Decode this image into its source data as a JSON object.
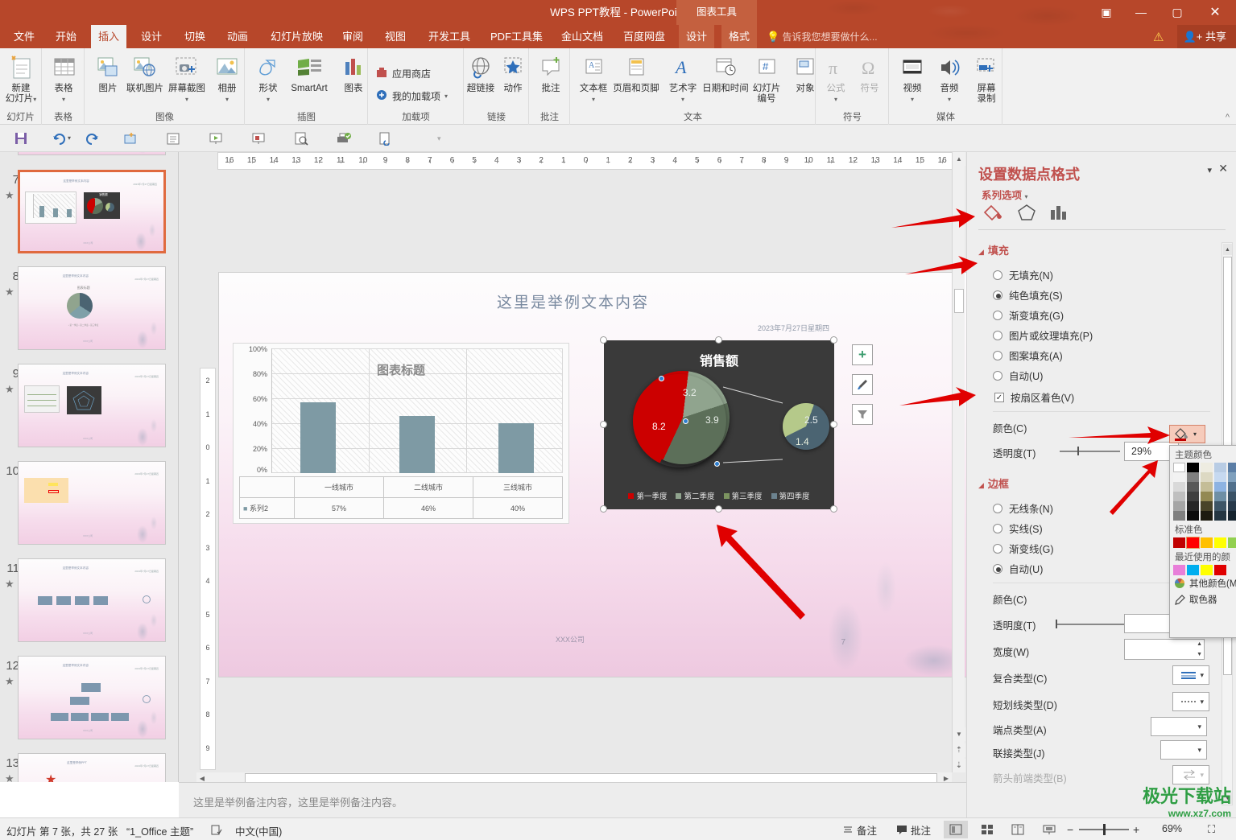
{
  "window": {
    "title": "WPS PPT教程 - PowerPoint",
    "chart_tools_label": "图表工具",
    "buttons": {
      "ribbon": "▣",
      "minimize": "—",
      "maximize": "▢",
      "close": "✕"
    }
  },
  "tabs": [
    {
      "label": "文件",
      "active": false
    },
    {
      "label": "开始",
      "active": false
    },
    {
      "label": "插入",
      "active": true
    },
    {
      "label": "设计",
      "active": false
    },
    {
      "label": "切换",
      "active": false
    },
    {
      "label": "动画",
      "active": false
    },
    {
      "label": "幻灯片放映",
      "active": false
    },
    {
      "label": "审阅",
      "active": false
    },
    {
      "label": "视图",
      "active": false
    },
    {
      "label": "开发工具",
      "active": false
    },
    {
      "label": "PDF工具集",
      "active": false
    },
    {
      "label": "金山文档",
      "active": false
    },
    {
      "label": "百度网盘",
      "active": false
    }
  ],
  "context_tabs": [
    {
      "label": "设计"
    },
    {
      "label": "格式"
    }
  ],
  "tell_me": "告诉我您想要做什么...",
  "share_label": "共享",
  "ribbon": {
    "groups": [
      {
        "label": "幻灯片",
        "items": [
          {
            "label": "新建\n幻灯片",
            "icon": "new-slide-icon",
            "dropdown": true
          }
        ]
      },
      {
        "label": "表格",
        "items": [
          {
            "label": "表格",
            "icon": "table-icon",
            "dropdown": true
          }
        ]
      },
      {
        "label": "图像",
        "items": [
          {
            "label": "图片",
            "icon": "picture-icon"
          },
          {
            "label": "联机图片",
            "icon": "online-picture-icon"
          },
          {
            "label": "屏幕截图",
            "icon": "screenshot-icon",
            "dropdown": true
          },
          {
            "label": "相册",
            "icon": "album-icon",
            "dropdown": true
          }
        ]
      },
      {
        "label": "插图",
        "items": [
          {
            "label": "形状",
            "icon": "shapes-icon",
            "dropdown": true
          },
          {
            "label": "SmartArt",
            "icon": "smartart-icon"
          },
          {
            "label": "图表",
            "icon": "chart-icon"
          }
        ]
      },
      {
        "label": "加载项",
        "items": [
          {
            "label": "应用商店",
            "icon": "store-icon"
          },
          {
            "label": "我的加载项",
            "icon": "my-addins-icon",
            "dropdown": true
          }
        ]
      },
      {
        "label": "链接",
        "items": [
          {
            "label": "超链接",
            "icon": "hyperlink-icon"
          },
          {
            "label": "动作",
            "icon": "action-icon"
          }
        ]
      },
      {
        "label": "批注",
        "items": [
          {
            "label": "批注",
            "icon": "comment-icon"
          }
        ]
      },
      {
        "label": "文本",
        "items": [
          {
            "label": "文本框",
            "icon": "textbox-icon",
            "dropdown": true
          },
          {
            "label": "页眉和页脚",
            "icon": "header-footer-icon"
          },
          {
            "label": "艺术字",
            "icon": "wordart-icon",
            "dropdown": true
          },
          {
            "label": "日期和时间",
            "icon": "date-time-icon"
          },
          {
            "label": "幻灯片\n编号",
            "icon": "slide-number-icon"
          },
          {
            "label": "对象",
            "icon": "object-icon"
          }
        ]
      },
      {
        "label": "符号",
        "items": [
          {
            "label": "公式",
            "icon": "equation-icon",
            "dropdown": true,
            "disabled": true
          },
          {
            "label": "符号",
            "icon": "symbol-icon",
            "disabled": true
          }
        ]
      },
      {
        "label": "媒体",
        "items": [
          {
            "label": "视频",
            "icon": "video-icon",
            "dropdown": true
          },
          {
            "label": "音频",
            "icon": "audio-icon",
            "dropdown": true
          },
          {
            "label": "屏幕\n录制",
            "icon": "screen-record-icon"
          }
        ]
      }
    ]
  },
  "qat": [
    {
      "name": "save-icon"
    },
    {
      "name": "undo-icon"
    },
    {
      "name": "redo-icon"
    },
    {
      "name": "new-slide-icon"
    },
    {
      "name": "outline-icon"
    },
    {
      "name": "slideshow-icon"
    },
    {
      "name": "present-icon"
    },
    {
      "name": "preview-icon"
    },
    {
      "name": "print-icon"
    },
    {
      "name": "link-doc-icon"
    },
    {
      "name": "qat-more-icon"
    }
  ],
  "thumbnails": [
    {
      "num": "7",
      "starred": true,
      "selected": true,
      "kind": "charts"
    },
    {
      "num": "8",
      "starred": true,
      "selected": false,
      "kind": "pie"
    },
    {
      "num": "9",
      "starred": true,
      "selected": false,
      "kind": "radar"
    },
    {
      "num": "10",
      "starred": false,
      "selected": false,
      "kind": "mindmap"
    },
    {
      "num": "11",
      "starred": true,
      "selected": false,
      "kind": "process"
    },
    {
      "num": "12",
      "starred": true,
      "selected": false,
      "kind": "orgchart"
    },
    {
      "num": "13",
      "starred": true,
      "selected": false,
      "kind": "icons"
    }
  ],
  "slide": {
    "title": "这里是举例文本内容",
    "date": "2023年7月27日星期四",
    "footer": "XXX公司",
    "page_number": "7"
  },
  "chart_data": [
    {
      "type": "bar",
      "title": "图表标题",
      "categories": [
        "一线城市",
        "二线城市",
        "三线城市"
      ],
      "series": [
        {
          "name": "系列2",
          "values": [
            57,
            46,
            40
          ],
          "labels": [
            "57%",
            "46%",
            "40%"
          ]
        }
      ],
      "ylabel": "",
      "xlabel": "",
      "ylim": [
        0,
        100
      ],
      "ytick_labels": [
        "100%",
        "80%",
        "60%",
        "40%",
        "20%",
        "0%"
      ],
      "grid": true,
      "legend_position": "table",
      "data_table": true,
      "bar_color": "#7e9aa4",
      "plot_bg": "#fdfdfd"
    },
    {
      "type": "pie",
      "subtype": "pie-of-pie",
      "title": "销售额",
      "categories": [
        "第一季度",
        "第二季度",
        "第三季度",
        "第四季度"
      ],
      "values": [
        8.2,
        3.2,
        3.9,
        2.5,
        1.4
      ],
      "data_labels": [
        "8.2",
        "3.2",
        "3.9",
        "2.5",
        "1.4"
      ],
      "legend": [
        "第一季度",
        "第二季度",
        "第三季度",
        "第四季度"
      ],
      "legend_position": "bottom",
      "colors": [
        "#cc0000",
        "#90a48e",
        "#5c6f59",
        "#4b6472",
        "#b5c98a"
      ],
      "background": "#3a3a3a",
      "selected_slice": "第一季度"
    }
  ],
  "chart_side_buttons": [
    {
      "name": "chart-elements-button",
      "glyph": "+"
    },
    {
      "name": "chart-styles-button",
      "glyph": "brush"
    },
    {
      "name": "chart-filters-button",
      "glyph": "funnel"
    }
  ],
  "taskpane": {
    "title": "设置数据点格式",
    "subtitle": "系列选项",
    "minimize": "▾",
    "close": "✕",
    "tabs": [
      {
        "name": "fill-line-icon",
        "active": true
      },
      {
        "name": "effects-icon",
        "active": false
      },
      {
        "name": "series-options-icon",
        "active": false
      }
    ],
    "fill": {
      "heading": "填充",
      "options": [
        {
          "label": "无填充(N)",
          "selected": false
        },
        {
          "label": "纯色填充(S)",
          "selected": true
        },
        {
          "label": "渐变填充(G)",
          "selected": false
        },
        {
          "label": "图片或纹理填充(P)",
          "selected": false
        },
        {
          "label": "图案填充(A)",
          "selected": false
        },
        {
          "label": "自动(U)",
          "selected": false
        }
      ],
      "checkbox": {
        "label": "按扇区着色(V)",
        "checked": true
      },
      "color_label": "颜色(C)",
      "transparency_label": "透明度(T)",
      "transparency_value": "29%"
    },
    "border": {
      "heading": "边框",
      "options": [
        {
          "label": "无线条(N)",
          "selected": false
        },
        {
          "label": "实线(S)",
          "selected": false
        },
        {
          "label": "渐变线(G)",
          "selected": false
        },
        {
          "label": "自动(U)",
          "selected": true
        }
      ],
      "rows": [
        {
          "label": "颜色(C)",
          "control": "color"
        },
        {
          "label": "透明度(T)",
          "control": "slider",
          "value": ""
        },
        {
          "label": "宽度(W)",
          "control": "spinner",
          "value": ""
        },
        {
          "label": "复合类型(C)",
          "control": "dropdown",
          "value": ""
        },
        {
          "label": "短划线类型(D)",
          "control": "dropdown",
          "value": ""
        },
        {
          "label": "端点类型(A)",
          "control": "dropdown",
          "value": ""
        },
        {
          "label": "联接类型(J)",
          "control": "dropdown",
          "value": ""
        },
        {
          "label": "箭头前端类型(B)",
          "control": "dropdown",
          "value": "",
          "disabled": true
        }
      ]
    }
  },
  "color_dropdown": {
    "theme_heading": "主题颜色",
    "standard_heading": "标准色",
    "recent_heading": "最近使用的颜",
    "theme_row1": [
      "#ffffff",
      "#000000",
      "#eeece1",
      "#b8cce4",
      "#5b7ea6"
    ],
    "theme_shades": [
      [
        "#f2f2f2",
        "#d9d9d9",
        "#bfbfbf",
        "#a6a6a6",
        "#808080"
      ],
      [
        "#7f7f7f",
        "#595959",
        "#3f3f3f",
        "#262626",
        "#0c0c0c"
      ],
      [
        "#ddd9c3",
        "#c4bd97",
        "#938953",
        "#494429",
        "#1d1b10"
      ],
      [
        "#c6d9f0",
        "#8db3e2",
        "#548dd4",
        "#17365d",
        "#0f243e"
      ],
      [
        "#dbe5f1",
        "#b8cce4",
        "#95b3d7",
        "#366092",
        "#244061"
      ]
    ],
    "standard_colors": [
      "#c00000",
      "#ff0000",
      "#ffc000",
      "#ffff00",
      "#92d050"
    ],
    "recent_colors": [
      "#e87fd9",
      "#00aeef",
      "#ffff00",
      "#e00000"
    ],
    "more_colors_label": "其他颜色(M",
    "eyedropper_label": "取色器",
    "selected_standard_index": 1
  },
  "notes": {
    "text": "这里是举例备注内容，这里是举例备注内容。"
  },
  "statusbar": {
    "slide_counter": "幻灯片 第 7 张，共 27 张",
    "theme": "“1_Office 主题”",
    "language": "中文(中国)",
    "notes_label": "备注",
    "comments_label": "批注",
    "zoom_value": "69%",
    "views": [
      {
        "name": "normal-view-button",
        "active": true
      },
      {
        "name": "slide-sorter-button",
        "active": false
      },
      {
        "name": "reading-view-button",
        "active": false
      },
      {
        "name": "slideshow-button",
        "active": false
      }
    ],
    "zoom_minus": "−",
    "zoom_plus": "+",
    "fit-slide": "⛶"
  },
  "ruler": {
    "h_labels": [
      "16",
      "15",
      "14",
      "13",
      "12",
      "11",
      "10",
      "9",
      "8",
      "7",
      "6",
      "5",
      "4",
      "3",
      "2",
      "1",
      "0",
      "1",
      "2",
      "3",
      "4",
      "5",
      "6",
      "7",
      "8",
      "9",
      "10",
      "11",
      "12",
      "13",
      "14",
      "15",
      "16"
    ],
    "v_labels": [
      "2",
      "1",
      "0",
      "1",
      "2",
      "3",
      "4",
      "5",
      "6",
      "7",
      "8",
      "9"
    ]
  },
  "watermark": {
    "text": "极光下载站",
    "url": "www.xz7.com"
  },
  "colors": {
    "accent": "#b7472a",
    "panel_heading": "#c0504d",
    "bar": "#7e9aa4",
    "pie_red": "#cc0000",
    "selection_border": "#e06a3f"
  }
}
